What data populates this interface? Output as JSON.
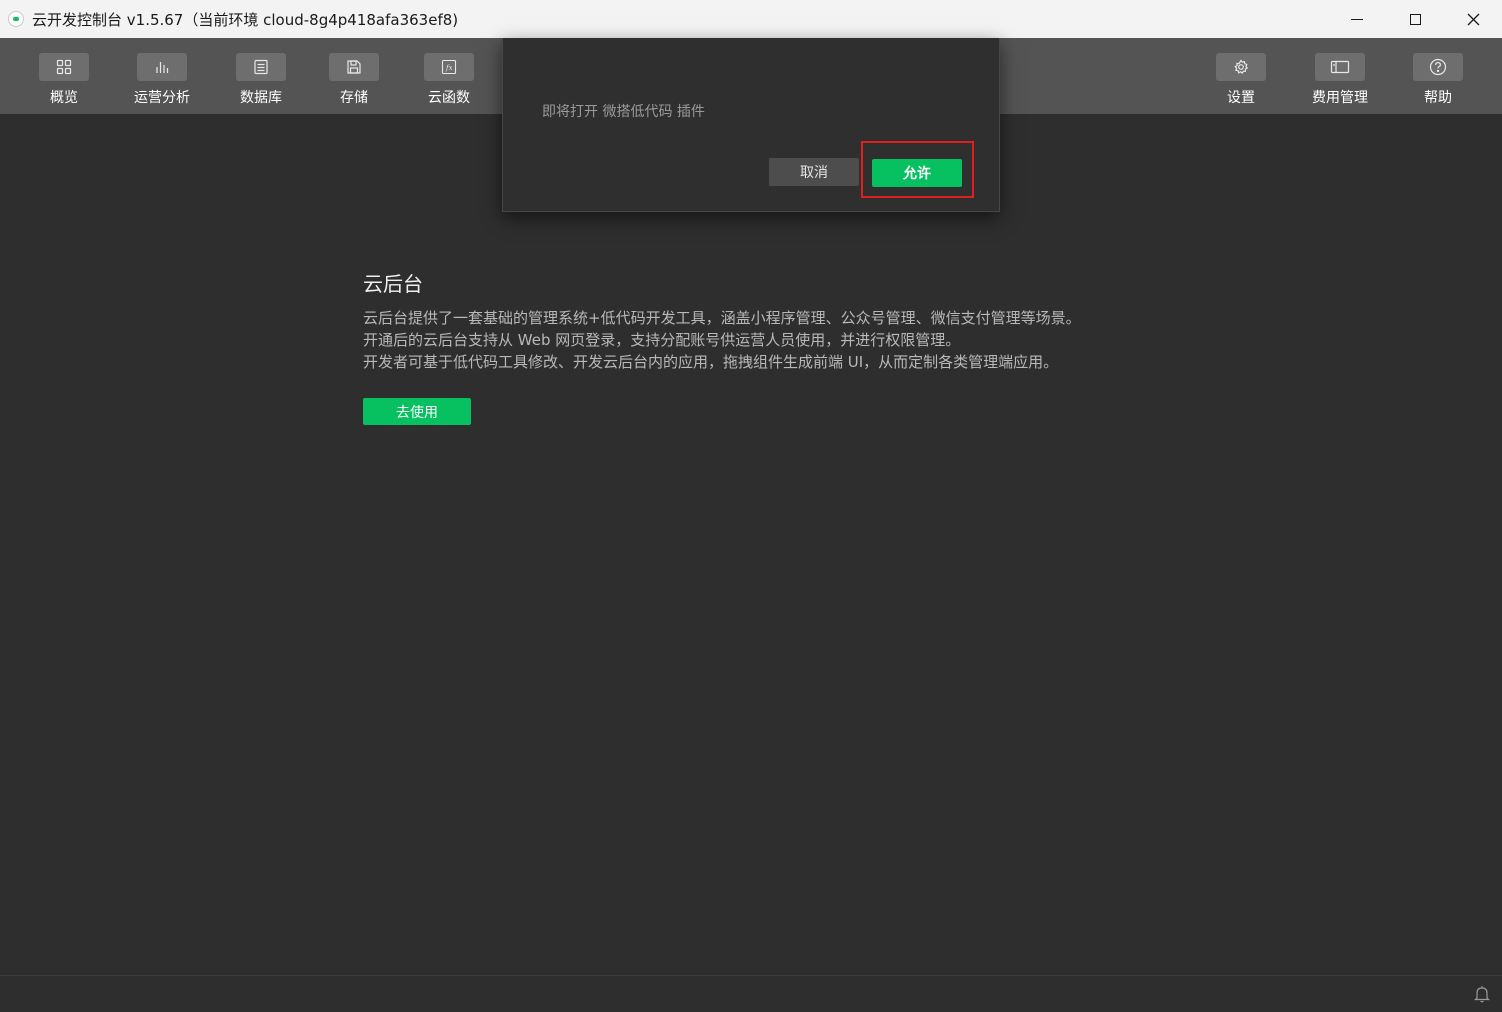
{
  "window": {
    "title": "云开发控制台 v1.5.67（当前环境 cloud-8g4p418afa363ef8)",
    "controls": [
      "minimize-icon",
      "maximize-icon",
      "close-icon"
    ]
  },
  "toolbar": {
    "left_items": [
      {
        "label": "概览",
        "icon": "grid-icon"
      },
      {
        "label": "运营分析",
        "icon": "bar-chart-icon"
      },
      {
        "label": "数据库",
        "icon": "database-icon"
      },
      {
        "label": "存储",
        "icon": "save-icon"
      },
      {
        "label": "云函数",
        "icon": "function-icon"
      }
    ],
    "right_items": [
      {
        "label": "设置",
        "icon": "gear-icon"
      },
      {
        "label": "费用管理",
        "icon": "billing-icon"
      },
      {
        "label": "帮助",
        "icon": "help-icon"
      }
    ]
  },
  "main": {
    "title": "云后台",
    "description": [
      "云后台提供了一套基础的管理系统+低代码开发工具，涵盖小程序管理、公众号管理、微信支付管理等场景。",
      "开通后的云后台支持从 Web 网页登录，支持分配账号供运营人员使用，并进行权限管理。",
      "开发者可基于低代码工具修改、开发云后台内的应用，拖拽组件生成前端 UI，从而定制各类管理端应用。"
    ],
    "use_button": "去使用"
  },
  "dialog": {
    "message": "即将打开 微搭低代码 插件",
    "cancel_label": "取消",
    "allow_label": "允许"
  },
  "colors": {
    "accent": "#07c160",
    "toolbar_bg": "#545454",
    "content_bg": "#2e2e2e",
    "highlight": "#e02020"
  }
}
